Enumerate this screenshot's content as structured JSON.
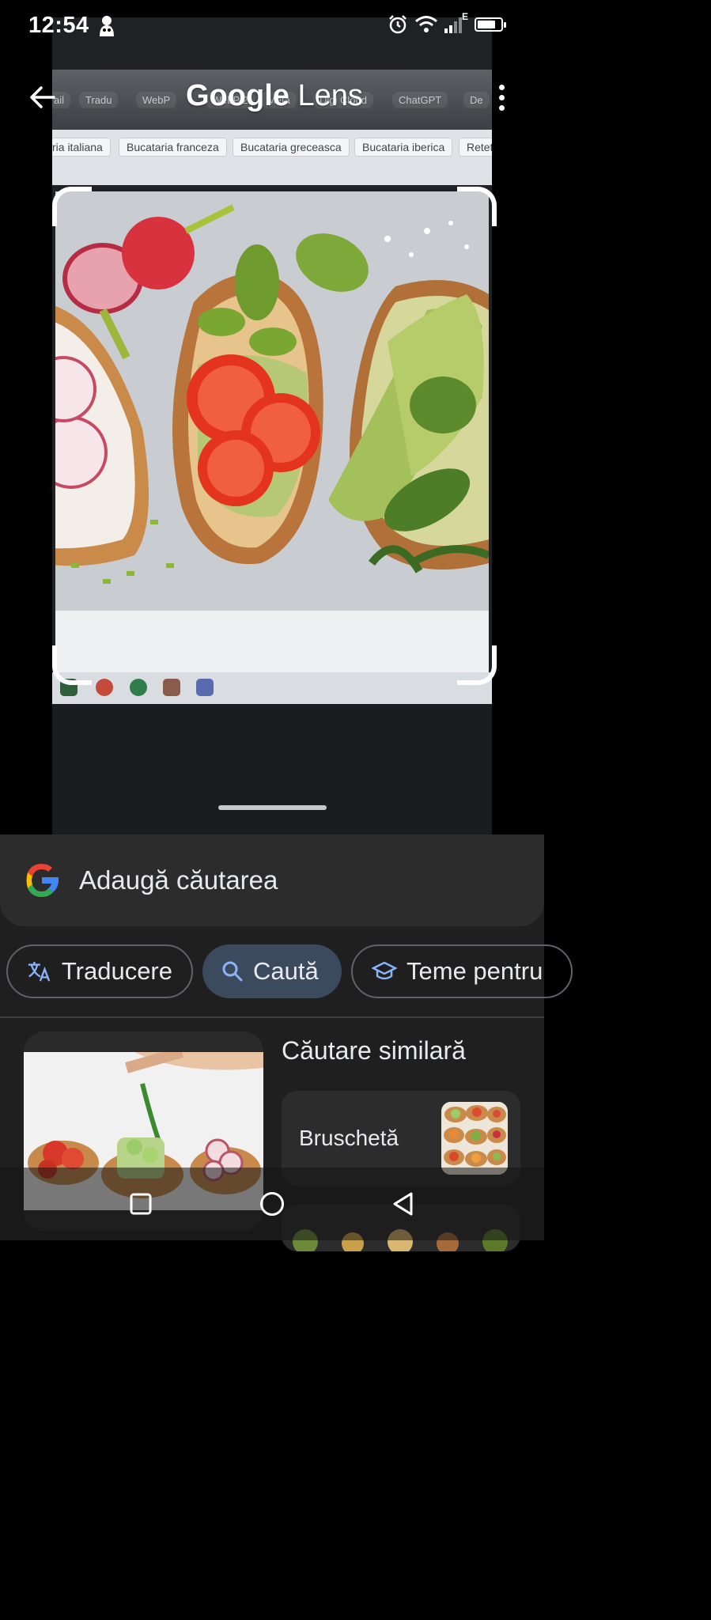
{
  "status_bar": {
    "time": "12:54",
    "network": "E",
    "icons": [
      "notification-icon",
      "alarm-icon",
      "wifi-icon",
      "signal-icon",
      "battery-icon"
    ],
    "battery_level": 0.8
  },
  "header": {
    "title_google": "Google",
    "title_lens": "Lens",
    "back_icon": "arrow-back-icon",
    "menu_icon": "more-vert-icon"
  },
  "photo": {
    "bookmarks": [
      "ail",
      "Tradu",
      "WebP",
      "WebP 2",
      "Meta",
      "Digi Cloud",
      "ChatGPT",
      "De"
    ],
    "tabs": [
      "ria italiana",
      "Bucataria franceza",
      "Bucataria greceasca",
      "Bucataria iberica",
      "Retet"
    ]
  },
  "search": {
    "placeholder": "Adaugă căutarea"
  },
  "chips": [
    {
      "label": "Traducere",
      "icon": "translate-icon"
    },
    {
      "label": "Caută",
      "icon": "search-icon"
    },
    {
      "label": "Teme pentru",
      "icon": "school-icon"
    }
  ],
  "results": {
    "similar_title": "Căutare similară",
    "similar_items": [
      {
        "label": "Bruschetă"
      }
    ]
  },
  "colors": {
    "accent_chip": "#3c4a5e",
    "chip_icon": "#8ab4f8",
    "sheet_bg": "#1f1f1f"
  },
  "navbar": {
    "icons": [
      "recents-square-icon",
      "home-circle-icon",
      "back-triangle-icon"
    ]
  }
}
